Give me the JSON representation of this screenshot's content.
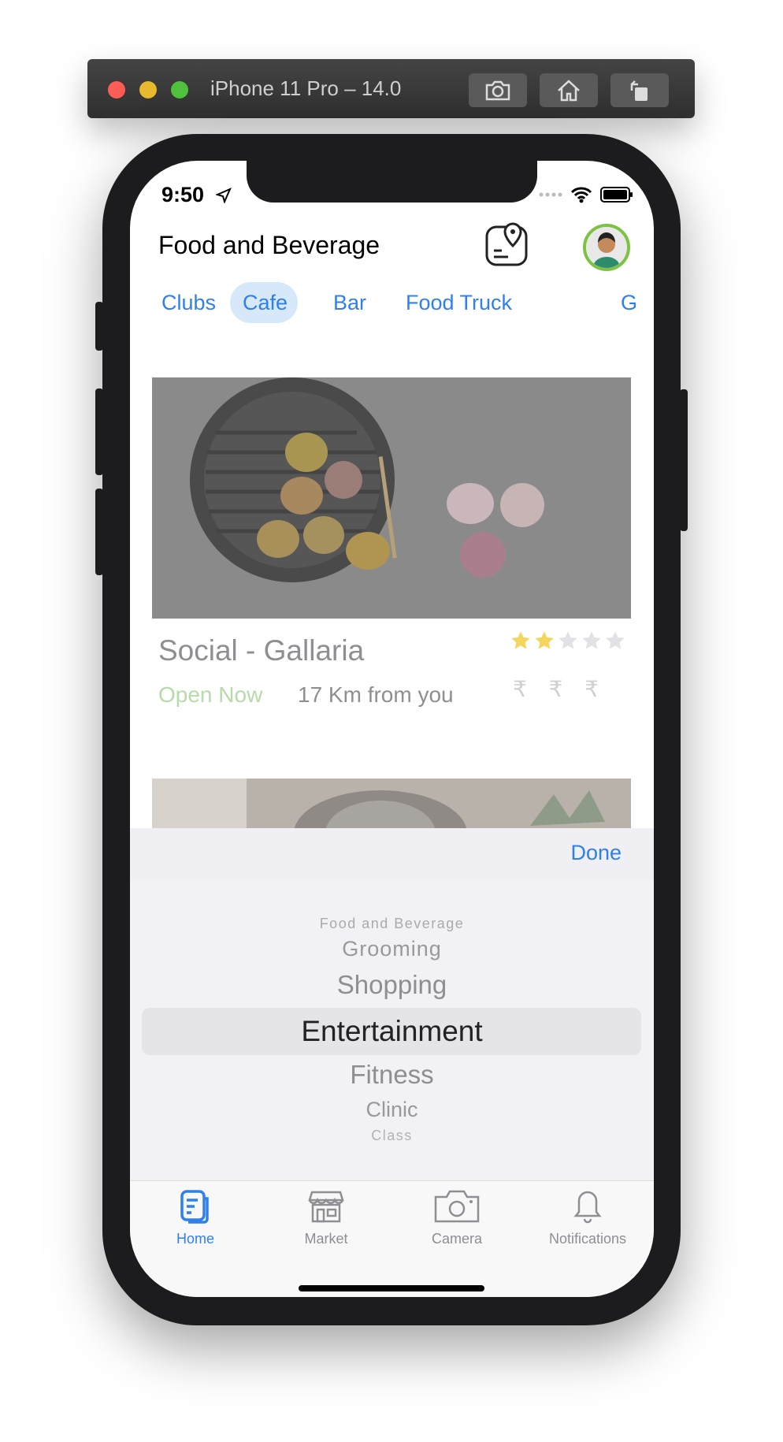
{
  "simulator": {
    "title": "iPhone 11 Pro – 14.0",
    "buttons": [
      "screenshot-icon",
      "home-icon",
      "rotate-icon"
    ]
  },
  "statusbar": {
    "time": "9:50"
  },
  "header": {
    "title": "Food and Beverage"
  },
  "category_tabs": [
    {
      "label": "Clubs",
      "active": false
    },
    {
      "label": "Cafe",
      "active": true
    },
    {
      "label": "Bar",
      "active": false
    },
    {
      "label": "Food Truck",
      "active": false
    },
    {
      "label": "G",
      "active": false
    }
  ],
  "listing": {
    "title": "Social - Gallaria",
    "rating": 2,
    "rating_max": 5,
    "status": "Open Now",
    "distance": "17 Km from you",
    "price": "₹ ₹ ₹"
  },
  "picker": {
    "done_label": "Done",
    "options": [
      "Food and Beverage",
      "Grooming",
      "Shopping",
      "Entertainment",
      "Fitness",
      "Clinic",
      "Class"
    ],
    "selected": "Entertainment"
  },
  "tabbar": {
    "items": [
      {
        "label": "Home",
        "icon": "home-doc-icon",
        "active": true
      },
      {
        "label": "Market",
        "icon": "market-icon",
        "active": false
      },
      {
        "label": "Camera",
        "icon": "camera-icon",
        "active": false
      },
      {
        "label": "Notifications",
        "icon": "bell-icon",
        "active": false
      }
    ]
  },
  "colors": {
    "accent": "#2f80ed",
    "open_status": "#b7dba8",
    "star": "#f5d65c",
    "avatar_ring": "#7cc243"
  }
}
